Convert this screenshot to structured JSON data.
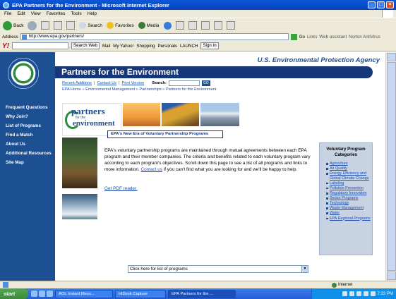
{
  "window": {
    "title": "EPA Partners for the Environment - Microsoft Internet Explorer",
    "minimize": "_",
    "maximize": "□",
    "close": "×"
  },
  "menu": [
    "File",
    "Edit",
    "View",
    "Favorites",
    "Tools",
    "Help"
  ],
  "toolbar": {
    "back": "Back",
    "search": "Search",
    "favorites": "Favorites",
    "media": "Media"
  },
  "address": {
    "label": "Address",
    "url": "http://www.epa.gov/partners/",
    "go": "Go",
    "links": "Links",
    "web_assistant": "Web assistant",
    "norton": "Norton AntiVirus"
  },
  "yahoo": {
    "logo": "Y!",
    "search_web": "Search Web",
    "mail": "Mail",
    "my_yahoo": "My Yahoo!",
    "shopping": "Shopping",
    "personals": "Personals",
    "launch": "LAUNCH",
    "sign_in": "Sign In"
  },
  "page": {
    "agency": "U.S. Environmental Protection Agency",
    "title": "Partners for the Environment",
    "top_links": [
      "Recent Additions",
      "Contact Us",
      "Print Version"
    ],
    "search_label": "Search:",
    "search_go": "GO",
    "breadcrumb": "EPA Home » Environmental Management » Partnerships » Partners for the Environment",
    "logo_line1": "partners",
    "logo_line2": "for the",
    "logo_line3": "environment",
    "tagline": "EPA's New Era of Voluntary Partnership Programs",
    "body_text_1": "EPA's voluntary partnership programs are maintained through mutual agreements between each EPA program and their member companies. The criteria and benefits related to each voluntary program vary according to each program's objectives. Scroll down this page to see a list of all programs and links to more information. ",
    "body_link": "Contact us",
    "body_text_2": " if you can't find what you are looking for and we'll be happy to help.",
    "pdf_link": "Get PDF reader.",
    "program_select": "Click here for list of programs"
  },
  "leftnav": [
    "Frequent Questions",
    "Why Join?",
    "List of Programs",
    "Find a Match",
    "About Us",
    "Additional Resources",
    "Site Map"
  ],
  "sidebox": {
    "title": "Voluntary Program Categories",
    "items": [
      "Agriculture",
      "Air Quality",
      "Energy Efficiency and Global Climate Change",
      "Labeling",
      "Pollution Prevention",
      "Regulatory Innovation",
      "Sector Programs",
      "Technology",
      "Waste Management",
      "Water",
      "EPA Regional Programs"
    ]
  },
  "status": {
    "zone": "Internet"
  },
  "taskbar": {
    "start": "start",
    "tasks": [
      "AOL Instant Mess...",
      "HiDesk Capture",
      "EPA Partners for the ..."
    ],
    "time": "7:23 PM"
  }
}
